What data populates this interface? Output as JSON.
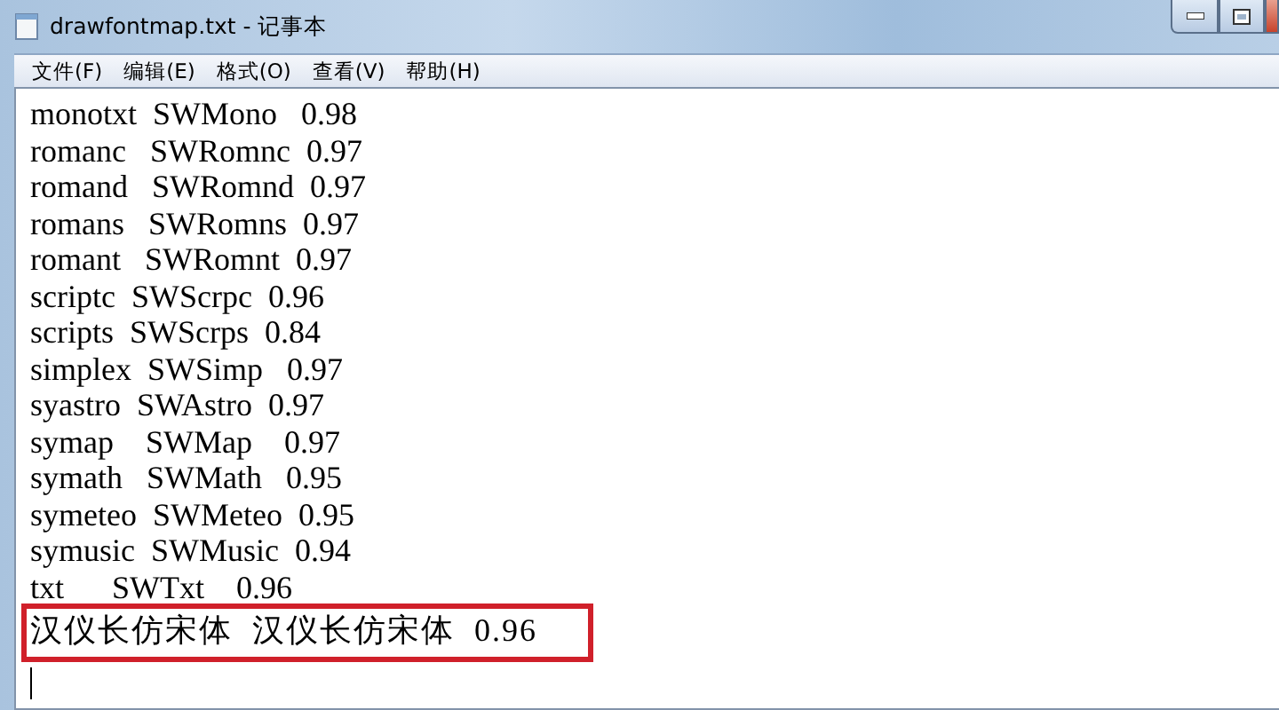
{
  "window": {
    "title": "drawfontmap.txt - 记事本"
  },
  "menu": [
    "文件(F)",
    "编辑(E)",
    "格式(O)",
    "查看(V)",
    "帮助(H)"
  ],
  "lines": [
    {
      "text": "monotxt  SWMono   0.98",
      "highlighted": false
    },
    {
      "text": "romanc   SWRomnc  0.97",
      "highlighted": false
    },
    {
      "text": "romand   SWRomnd  0.97",
      "highlighted": false
    },
    {
      "text": "romans   SWRomns  0.97",
      "highlighted": false
    },
    {
      "text": "romant   SWRomnt  0.97",
      "highlighted": false
    },
    {
      "text": "scriptc  SWScrpc  0.96",
      "highlighted": false
    },
    {
      "text": "scripts  SWScrps  0.84",
      "highlighted": false
    },
    {
      "text": "simplex  SWSimp   0.97",
      "highlighted": false
    },
    {
      "text": "syastro  SWAstro  0.97",
      "highlighted": false
    },
    {
      "text": "symap    SWMap    0.97",
      "highlighted": false
    },
    {
      "text": "symath   SWMath   0.95",
      "highlighted": false
    },
    {
      "text": "symeteo  SWMeteo  0.95",
      "highlighted": false
    },
    {
      "text": "symusic  SWMusic  0.94",
      "highlighted": false
    },
    {
      "text": "txt      SWTxt    0.96",
      "highlighted": false
    },
    {
      "text": "汉仪长仿宋体  汉仪长仿宋体  0.96",
      "highlighted": true
    }
  ]
}
